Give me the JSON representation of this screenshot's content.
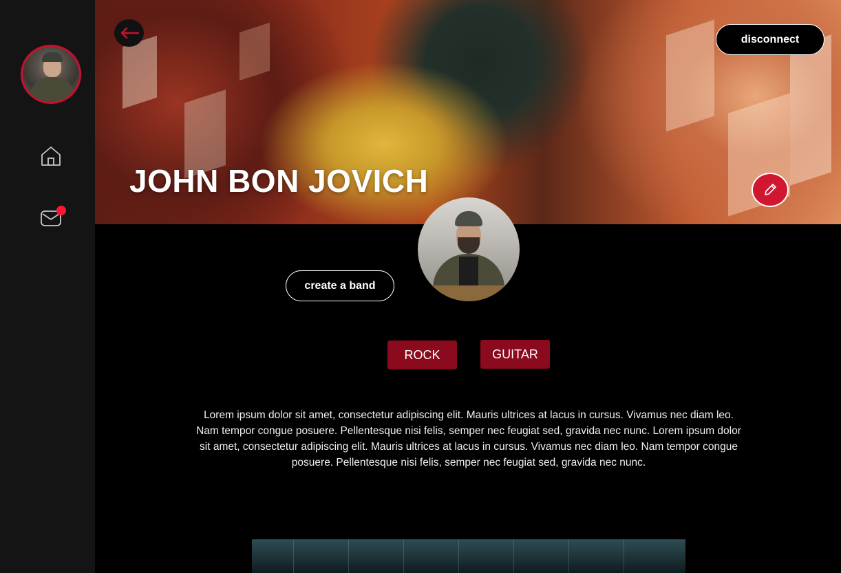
{
  "sidebar": {
    "avatar_icon": "user-avatar",
    "home_icon": "home-icon",
    "mail_icon": "mail-icon",
    "notification_color": "#ff1433"
  },
  "hero": {
    "title": "JOHN BON JOVICH",
    "back_icon": "arrow-left-icon",
    "disconnect_label": "disconnect",
    "edit_icon": "pencil-icon"
  },
  "profile": {
    "create_band_label": "create a band",
    "tags": [
      "ROCK",
      "GUITAR"
    ],
    "bio": "Lorem ipsum dolor sit amet, consectetur adipiscing elit. Mauris ultrices at lacus in cursus. Vivamus nec diam leo. Nam tempor congue posuere. Pellentesque nisi felis, semper nec feugiat sed, gravida nec nunc. Lorem ipsum dolor sit amet, consectetur adipiscing elit. Mauris ultrices at lacus in cursus. Vivamus nec diam leo. Nam tempor congue posuere. Pellentesque nisi felis, semper nec feugiat sed, gravida nec nunc."
  },
  "colors": {
    "accent": "#d0172f",
    "tag_background": "#8b0a1e",
    "sidebar_background": "#141414",
    "page_background": "#000000"
  }
}
